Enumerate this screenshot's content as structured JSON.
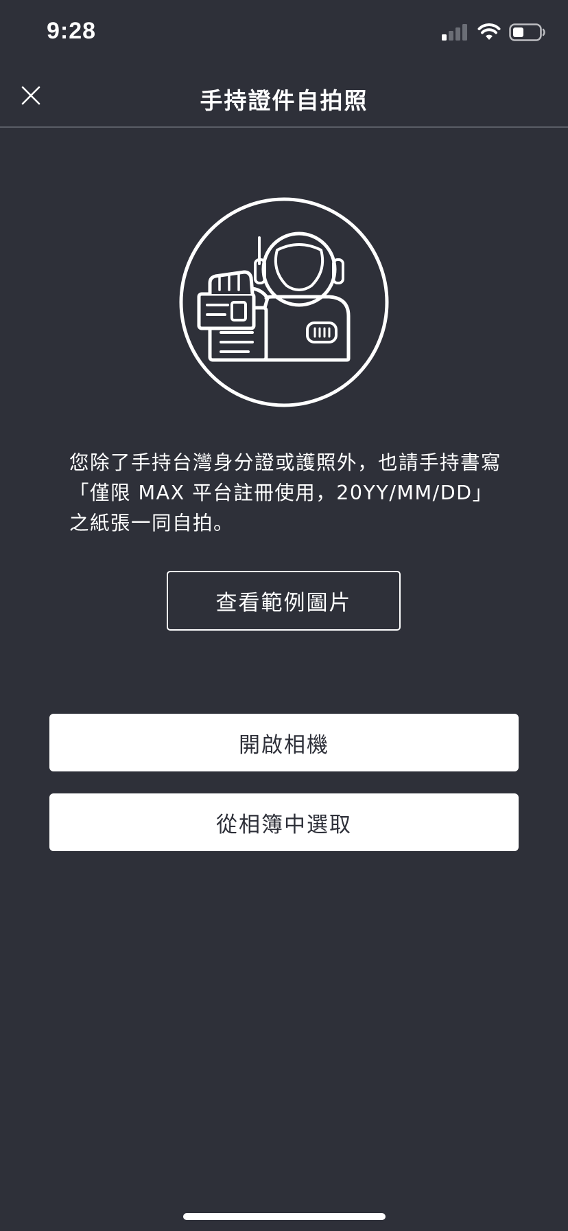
{
  "status_bar": {
    "time": "9:28",
    "icons": [
      "cellular-signal-icon",
      "wifi-icon",
      "battery-icon"
    ]
  },
  "nav": {
    "close_icon": "close-icon",
    "title": "手持證件自拍照"
  },
  "illustration": {
    "icon": "astronaut-holding-id-card-icon"
  },
  "instruction": {
    "text": "您除了手持台灣身分證或護照外，也請手持書寫「僅限 MAX 平台註冊使用，20YY/MM/DD」之紙張一同自拍。"
  },
  "buttons": {
    "example_label": "查看範例圖片",
    "open_camera_label": "開啟相機",
    "choose_album_label": "從相簿中選取"
  },
  "colors": {
    "background": "#2e3039",
    "foreground": "#ffffff",
    "divider": "#5a5d66"
  }
}
